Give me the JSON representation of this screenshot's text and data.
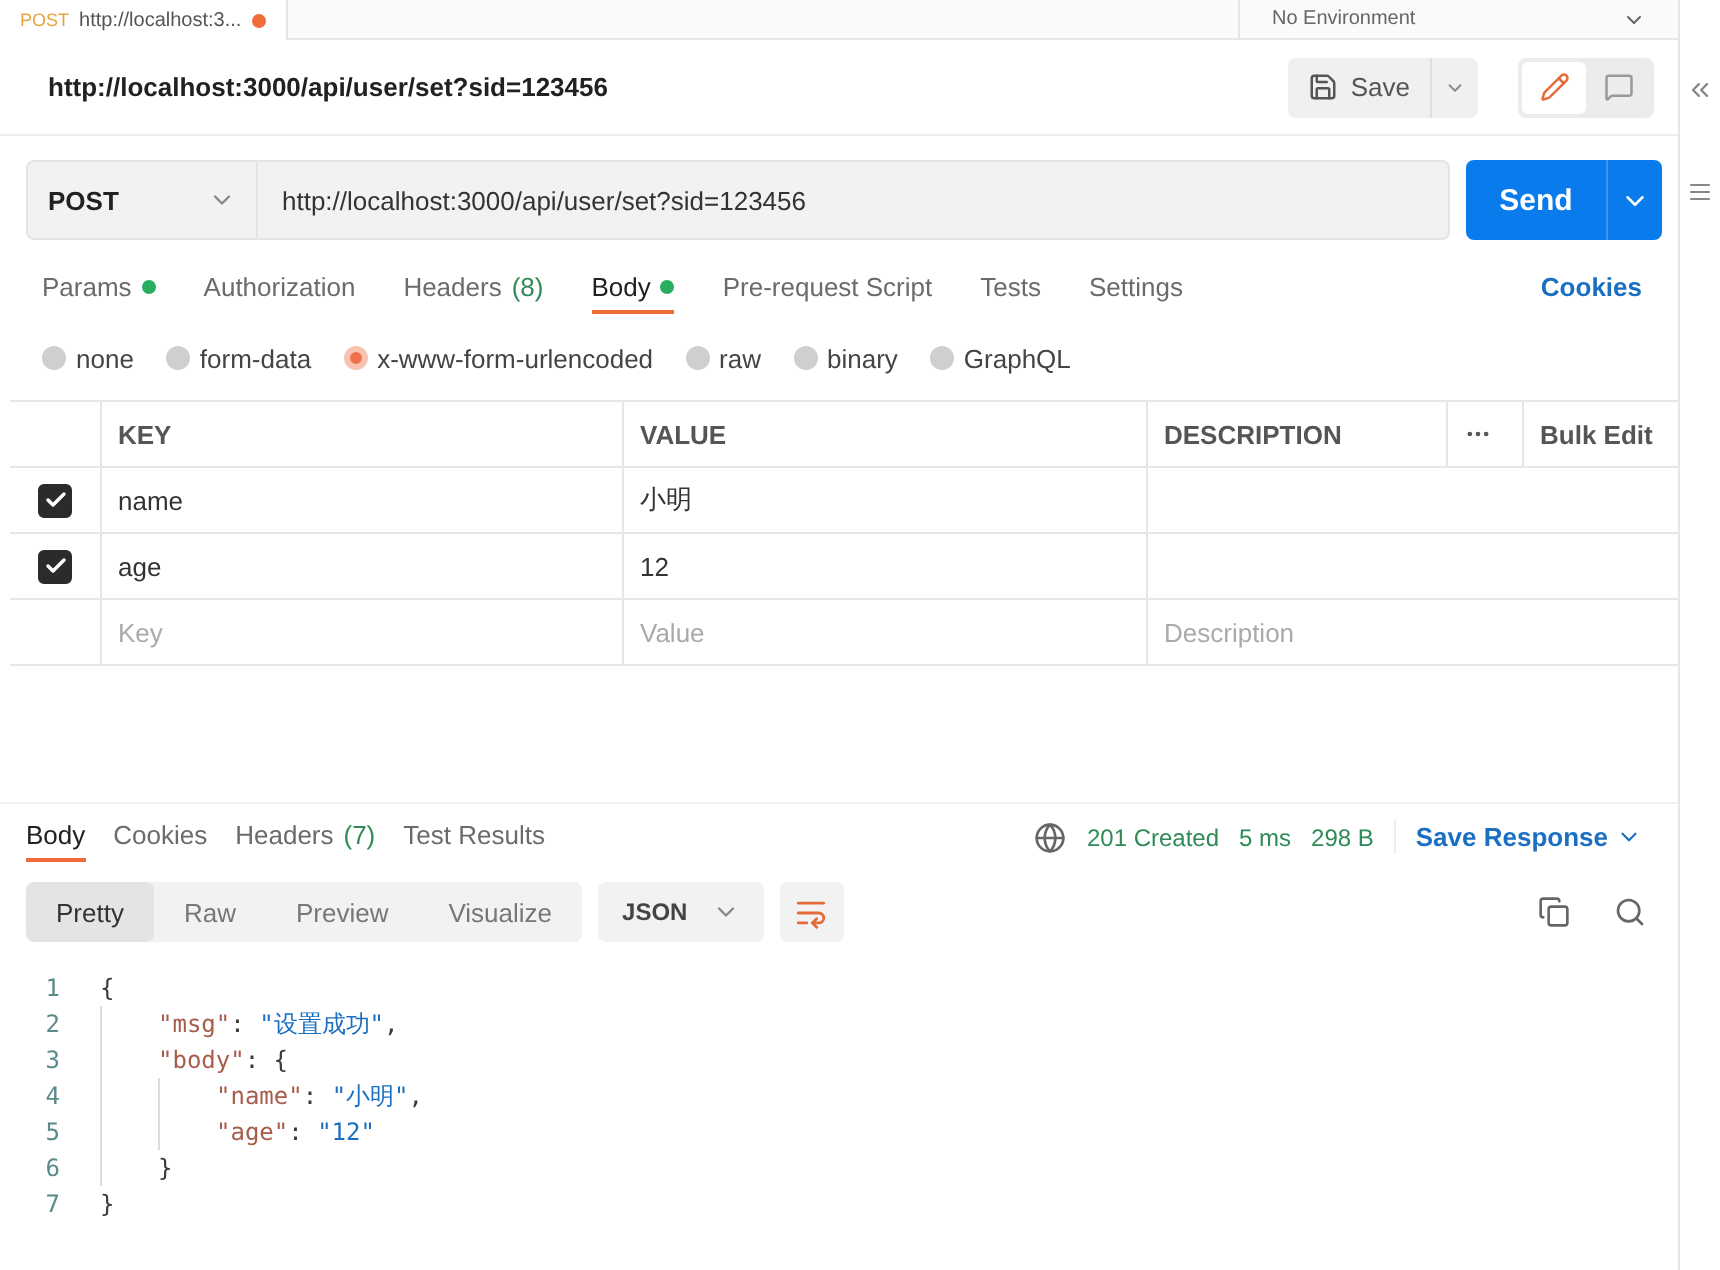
{
  "top_tabs": [
    {
      "method": "POST",
      "title": "http://localhost:3...",
      "unsaved": true
    }
  ],
  "environment": "No Environment",
  "request_title": "http://localhost:3000/api/user/set?sid=123456",
  "save_label": "Save",
  "method": "POST",
  "url": "http://localhost:3000/api/user/set?sid=123456",
  "send_label": "Send",
  "request_tabs": [
    {
      "label": "Params",
      "dot": true,
      "selected": false
    },
    {
      "label": "Authorization",
      "dot": false,
      "selected": false
    },
    {
      "label": "Headers",
      "count": "(8)",
      "dot": false,
      "selected": false
    },
    {
      "label": "Body",
      "dot": true,
      "selected": true
    },
    {
      "label": "Pre-request Script",
      "dot": false,
      "selected": false
    },
    {
      "label": "Tests",
      "dot": false,
      "selected": false
    },
    {
      "label": "Settings",
      "dot": false,
      "selected": false
    }
  ],
  "cookies_link": "Cookies",
  "body_types": [
    {
      "label": "none",
      "selected": false
    },
    {
      "label": "form-data",
      "selected": false
    },
    {
      "label": "x-www-form-urlencoded",
      "selected": true
    },
    {
      "label": "raw",
      "selected": false
    },
    {
      "label": "binary",
      "selected": false
    },
    {
      "label": "GraphQL",
      "selected": false
    }
  ],
  "table": {
    "columns": [
      "KEY",
      "VALUE",
      "DESCRIPTION"
    ],
    "bulk_edit": "Bulk Edit",
    "rows": [
      {
        "key": "name",
        "value": "小明",
        "checked": true
      },
      {
        "key": "age",
        "value": "12",
        "checked": true
      }
    ],
    "new_row": {
      "key_placeholder": "Key",
      "value_placeholder": "Value",
      "description_placeholder": "Description"
    }
  },
  "response_tabs": [
    {
      "label": "Body",
      "selected": true
    },
    {
      "label": "Cookies",
      "selected": false
    },
    {
      "label": "Headers",
      "count": "(7)",
      "selected": false
    },
    {
      "label": "Test Results",
      "selected": false
    }
  ],
  "status": "201 Created",
  "time": "5 ms",
  "size": "298 B",
  "save_response": "Save Response",
  "view_modes": [
    {
      "label": "Pretty",
      "selected": true
    },
    {
      "label": "Raw",
      "selected": false
    },
    {
      "label": "Preview",
      "selected": false
    },
    {
      "label": "Visualize",
      "selected": false
    }
  ],
  "format": "JSON",
  "code_lines": [
    {
      "number": "1",
      "tokens": [
        {
          "kind": "punct",
          "text": "{"
        }
      ],
      "children": [
        {
          "number": "2",
          "tokens": [
            {
              "kind": "key",
              "text": "\"msg\""
            },
            {
              "kind": "punct",
              "text": ": "
            },
            {
              "kind": "string",
              "text": "\"设置成功\""
            },
            {
              "kind": "punct",
              "text": ","
            }
          ]
        },
        {
          "number": "3",
          "tokens": [
            {
              "kind": "key",
              "text": "\"body\""
            },
            {
              "kind": "punct",
              "text": ": {"
            }
          ],
          "children": [
            {
              "number": "4",
              "tokens": [
                {
                  "kind": "key",
                  "text": "\"name\""
                },
                {
                  "kind": "punct",
                  "text": ": "
                },
                {
                  "kind": "string",
                  "text": "\"小明\""
                },
                {
                  "kind": "punct",
                  "text": ","
                }
              ]
            },
            {
              "number": "5",
              "tokens": [
                {
                  "kind": "key",
                  "text": "\"age\""
                },
                {
                  "kind": "punct",
                  "text": ": "
                },
                {
                  "kind": "string",
                  "text": "\"12\""
                }
              ]
            }
          ]
        },
        {
          "number": "6",
          "tokens": [
            {
              "kind": "punct",
              "text": "}"
            }
          ]
        }
      ]
    },
    {
      "number": "7",
      "tokens": [
        {
          "kind": "punct",
          "text": "}"
        }
      ]
    }
  ]
}
